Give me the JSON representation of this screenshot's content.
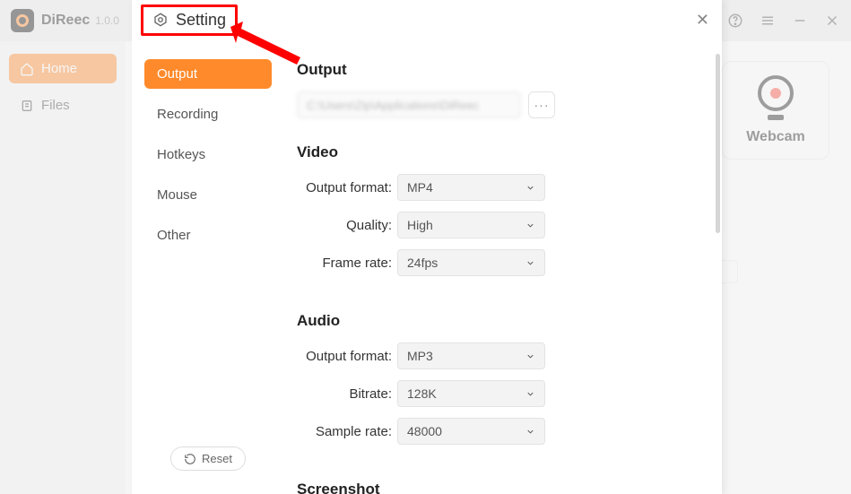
{
  "app": {
    "name": "DiReec",
    "version": "1.0.0",
    "sidebar": {
      "home": "Home",
      "files": "Files"
    },
    "webcam_label": "Webcam"
  },
  "modal": {
    "title": "Setting",
    "close": "✕",
    "nav": {
      "output": "Output",
      "recording": "Recording",
      "hotkeys": "Hotkeys",
      "mouse": "Mouse",
      "other": "Other"
    },
    "reset": "Reset",
    "sections": {
      "output": {
        "title": "Output",
        "path_value": "C:\\Users\\Zip\\Applications\\DiReec",
        "more": "···"
      },
      "video": {
        "title": "Video",
        "output_format_label": "Output format:",
        "output_format_value": "MP4",
        "quality_label": "Quality:",
        "quality_value": "High",
        "framerate_label": "Frame rate:",
        "framerate_value": "24fps"
      },
      "audio": {
        "title": "Audio",
        "output_format_label": "Output format:",
        "output_format_value": "MP3",
        "bitrate_label": "Bitrate:",
        "bitrate_value": "128K",
        "samplerate_label": "Sample rate:",
        "samplerate_value": "48000"
      },
      "screenshot": {
        "title": "Screenshot"
      }
    }
  }
}
